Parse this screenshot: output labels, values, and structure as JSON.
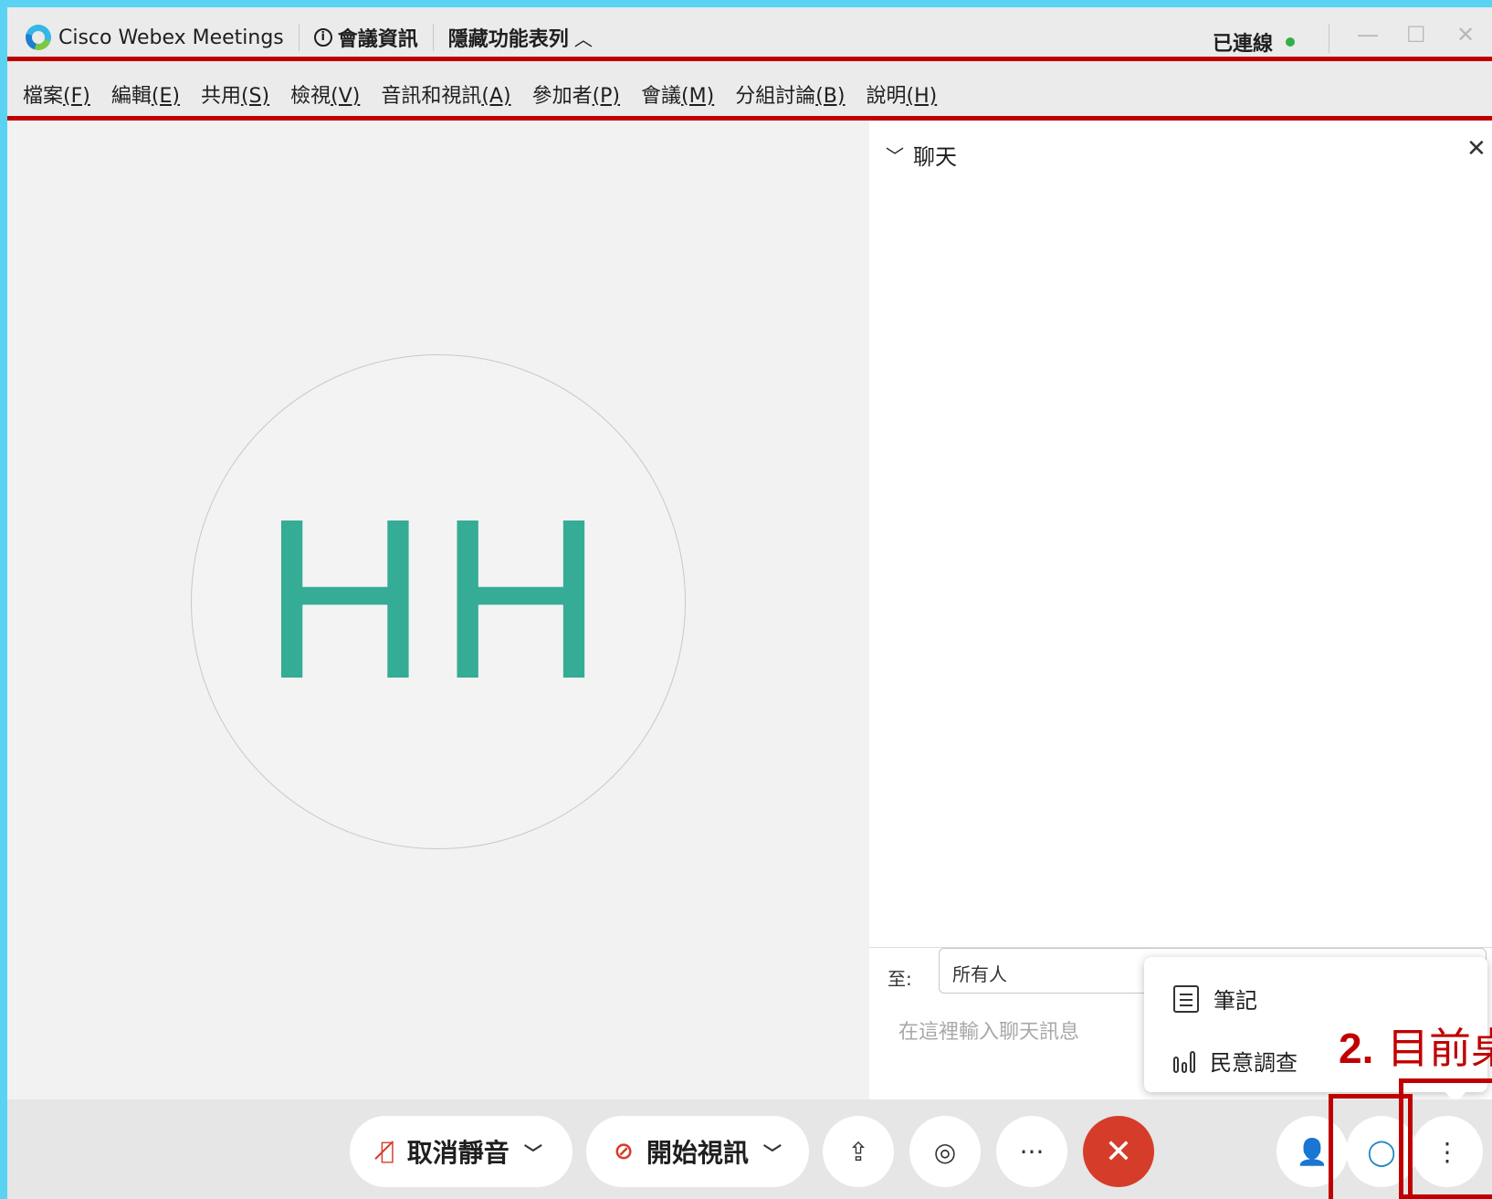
{
  "titlebar": {
    "app_title": "Cisco Webex Meetings",
    "meeting_info": "會議資訊",
    "hide_menu": "隱藏功能表列",
    "status": "已連線",
    "minimize": "—",
    "maximize": "☐",
    "close": "✕"
  },
  "menubar": {
    "items": [
      {
        "label": "檔案",
        "key": "(F)"
      },
      {
        "label": "編輯",
        "key": "(E)"
      },
      {
        "label": "共用",
        "key": "(S)"
      },
      {
        "label": "檢視",
        "key": "(V)"
      },
      {
        "label": "音訊和視訊",
        "key": "(A)"
      },
      {
        "label": "參加者",
        "key": "(P)"
      },
      {
        "label": "會議",
        "key": "(M)"
      },
      {
        "label": "分組討論",
        "key": "(B)"
      },
      {
        "label": "說明",
        "key": "(H)"
      }
    ]
  },
  "stage": {
    "avatar_initials": "HH"
  },
  "chat": {
    "title": "聊天",
    "to_label": "至:",
    "to_value": "所有人",
    "input_placeholder": "在這裡輸入聊天訊息"
  },
  "popup": {
    "notes": "筆記",
    "polling": "民意調查"
  },
  "annotation": {
    "number": "2.",
    "text": "目前桌"
  },
  "controls": {
    "unmute": "取消靜音",
    "start_video": "開始視訊",
    "more": "···"
  },
  "icons": {
    "mic_muted": "mic-off-icon",
    "video_off": "video-off-icon",
    "share": "share-icon",
    "record": "record-icon",
    "end": "end-meeting-icon",
    "participants": "participants-icon",
    "chat": "chat-icon",
    "more_vertical": "more-vertical-icon"
  },
  "colors": {
    "annotation_red": "#c00000",
    "avatar_teal": "#35ac95",
    "end_red": "#d63c2a",
    "chat_blue": "#1d86c5",
    "connected_green": "#30b04a"
  }
}
